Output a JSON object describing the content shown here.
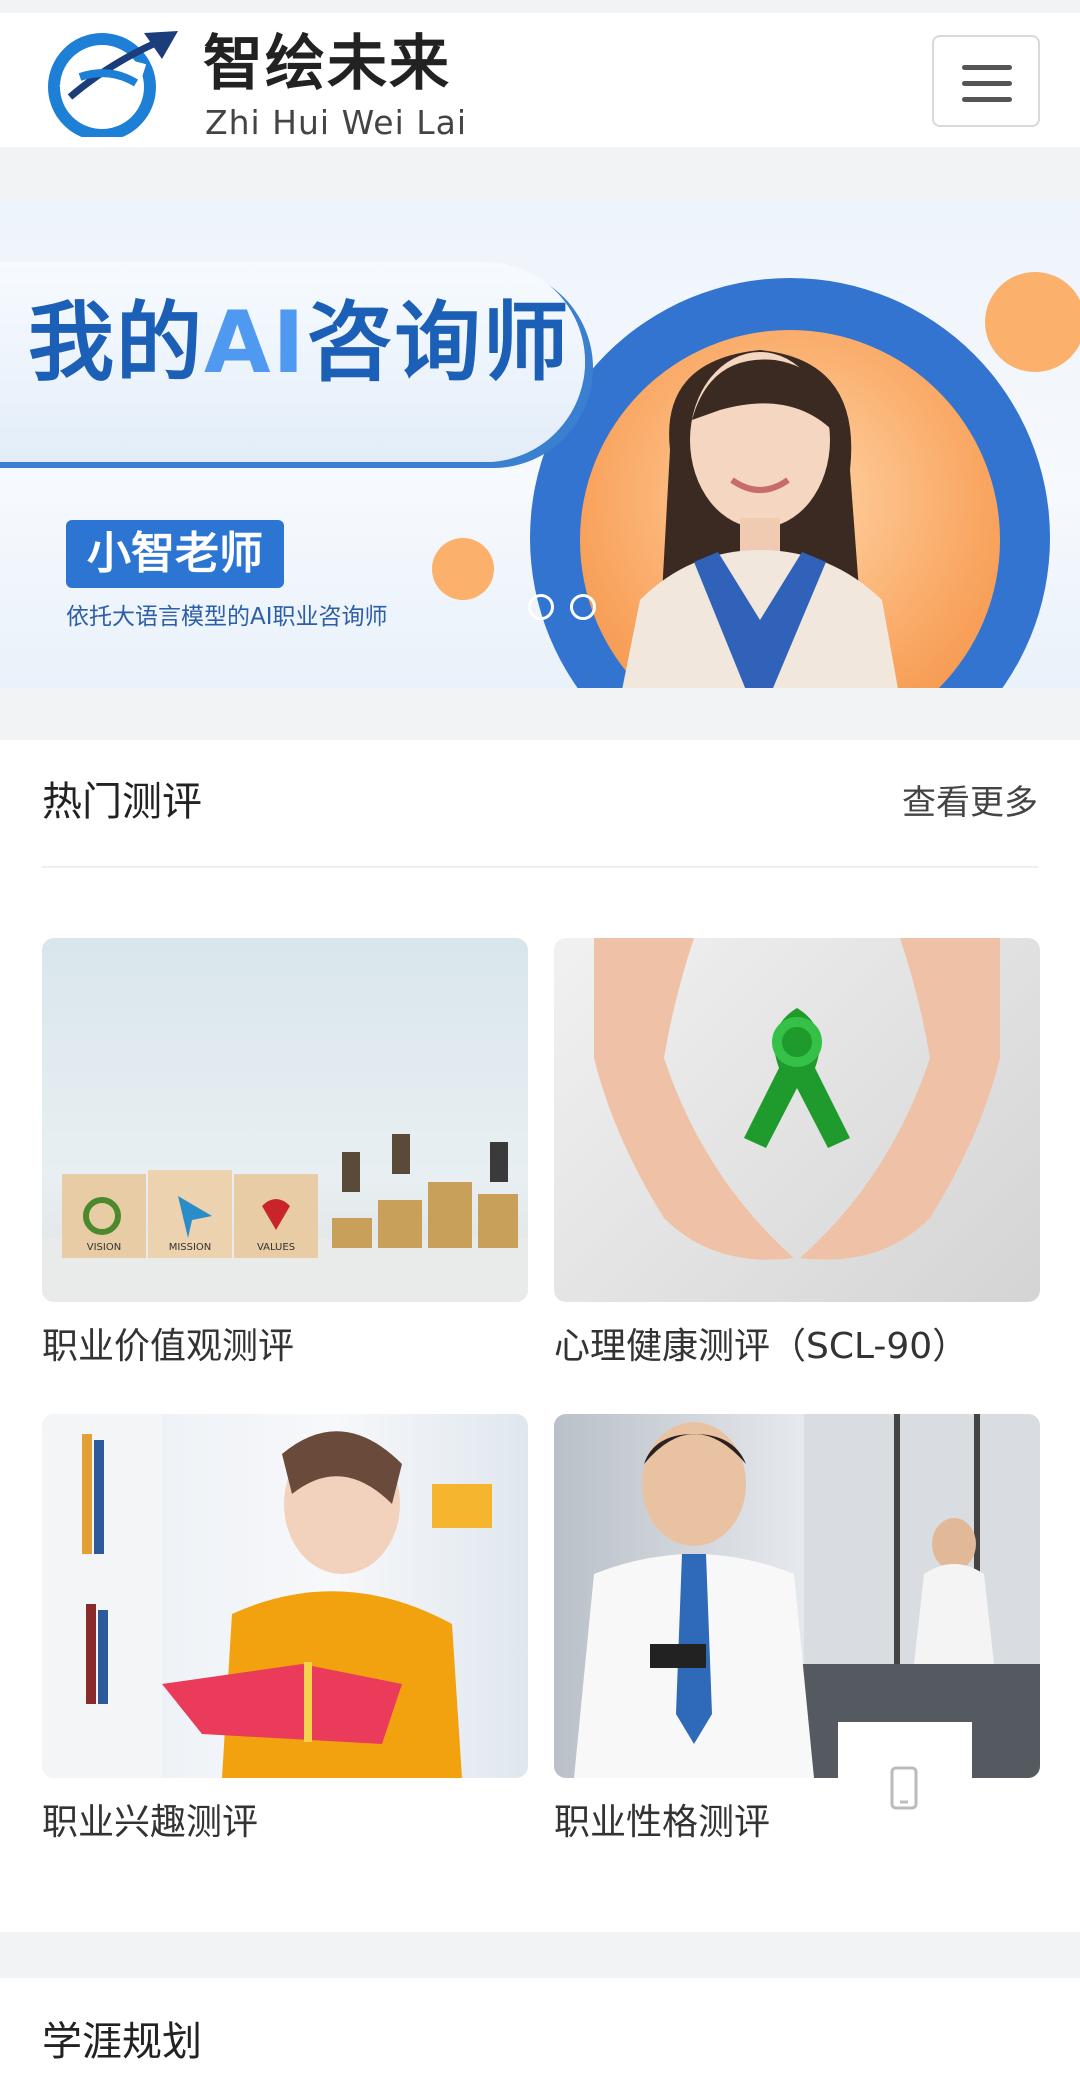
{
  "header": {
    "brand_cn": "智绘未来",
    "brand_en": "Zhi Hui Wei Lai",
    "menu_icon": "hamburger-menu-icon"
  },
  "banner": {
    "title_part1": "我的",
    "title_ai": "AI",
    "title_part2": "咨询师",
    "tag": "小智老师",
    "subtitle": "依托大语言模型的AI职业咨询师",
    "colors": {
      "primary": "#2d75d2",
      "accent": "#f9a560"
    }
  },
  "hot_tests": {
    "title": "热门测评",
    "more": "查看更多",
    "items": [
      {
        "label": "职业价值观测评",
        "image": "vision-mission-values-blocks",
        "block_words": [
          "VISION",
          "MISSION",
          "VALUES"
        ]
      },
      {
        "label": "心理健康测评（SCL-90）",
        "image": "hands-holding-green-ribbon"
      },
      {
        "label": "职业兴趣测评",
        "image": "woman-reading-book"
      },
      {
        "label": "职业性格测评",
        "image": "businessman-with-phone"
      }
    ]
  },
  "floating": {
    "icon": "mobile-phone-icon"
  },
  "career_planning": {
    "title": "学涯规划"
  }
}
